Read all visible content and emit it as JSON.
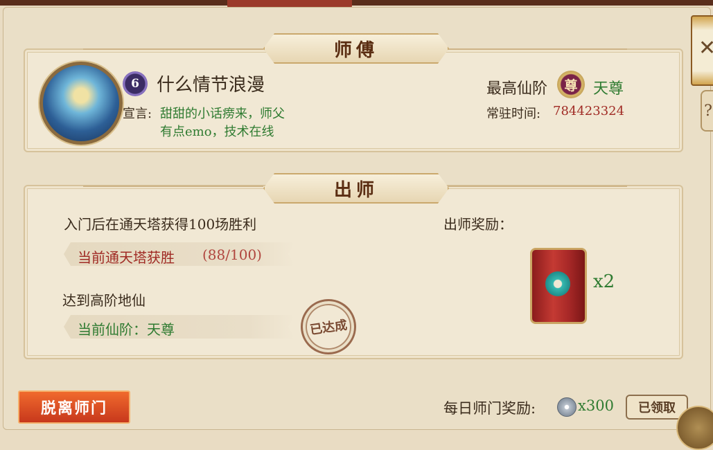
{
  "master_section": {
    "title": "师傅",
    "level": "6",
    "name": "什么情节浪漫",
    "declaration_label": "宣言:",
    "declaration_line1": "甜甜的小话痨来，师父",
    "declaration_line2": "有点emo，技术在线",
    "highest_rank_label": "最高仙阶",
    "rank_icon_char": "尊",
    "highest_rank_value": "天尊",
    "resident_time_label": "常驻时间:",
    "resident_time_value": "784423324"
  },
  "graduation_section": {
    "title": "出师",
    "req1_text": "入门后在通天塔获得100场胜利",
    "req1_progress_label": "当前通天塔获胜",
    "req1_progress_value": "(88/100)",
    "req2_text": "达到高阶地仙",
    "req2_progress_text": "当前仙阶：天尊",
    "req2_stamp": "已达成",
    "reward_label": "出师奖励：",
    "reward_qty": "x2",
    "req1_progress_fraction": 0.88
  },
  "footer": {
    "leave_button": "脱离师门",
    "daily_reward_label": "每日师门奖励:",
    "daily_reward_qty": "x300",
    "claimed_button": "已领取"
  },
  "colors": {
    "accent_green": "#2f7b31",
    "accent_red": "#a02a24",
    "button_orange": "#e6532a"
  },
  "icons": {
    "close": "close-icon",
    "help": "help-icon",
    "coin": "silver-coin-icon",
    "gift": "red-gift-box-icon"
  }
}
